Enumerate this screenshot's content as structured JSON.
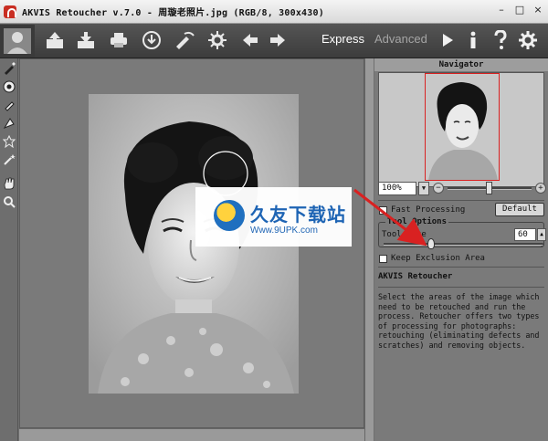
{
  "window": {
    "title": "AKVIS Retoucher v.7.0 - 周璇老照片.jpg (RGB/8, 300x430)",
    "controls": [
      "–",
      "□",
      "×"
    ]
  },
  "toolbar": {
    "buttons": [
      {
        "name": "open-icon"
      },
      {
        "name": "save-icon"
      },
      {
        "name": "print-icon"
      },
      {
        "name": "share-icon"
      },
      {
        "name": "preferences-icon"
      },
      {
        "name": "settings-gear-icon"
      },
      {
        "name": "undo-arrow-icon"
      },
      {
        "name": "redo-arrow-icon"
      }
    ],
    "mode_express": "Express",
    "mode_advanced": "Advanced",
    "run_icon": "play-icon",
    "info_icon": "info-icon",
    "help_icon": "help-icon",
    "settings_icon": "gear-icon"
  },
  "left_tools": [
    "selection-pencil-icon",
    "eraser-icon",
    "brush-icon",
    "clone-stamp-icon",
    "patch-icon",
    "magic-wand-icon",
    "hand-icon",
    "zoom-icon"
  ],
  "navigator": {
    "title": "Navigator",
    "zoom_value": "100%"
  },
  "options": {
    "fast_processing_label": "Fast Processing",
    "fast_processing_checked": false,
    "default_button": "Default",
    "group_title": "Tool Options",
    "tool_size_label": "Tool Size",
    "tool_size_value": "60",
    "tool_size_fraction": 0.3,
    "keep_exclusion_label": "Keep Exclusion Area",
    "keep_exclusion_checked": false
  },
  "help": {
    "title": "AKVIS Retoucher",
    "text": "Select the areas of the image which need to be retouched and run the process. Retoucher offers two types of processing for photographs: retouching (eliminating defects and scratches) and removing objects."
  },
  "watermark": {
    "cn": "久友下载站",
    "url": "Www.9UPK.com"
  },
  "colors": {
    "toolbar_bg": "#444444",
    "accent_red": "#d92121",
    "watermark_blue": "#1e64b4"
  }
}
